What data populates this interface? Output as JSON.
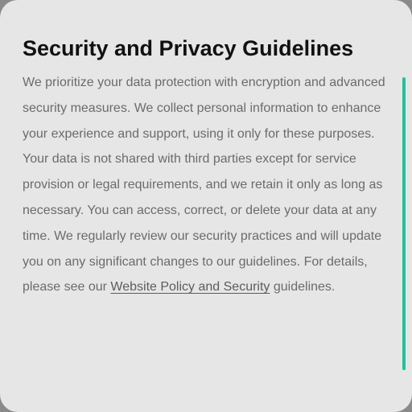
{
  "card": {
    "title": "Security and Privacy Guidelines",
    "body_text": "We prioritize your data protection with encryption and advanced security measures. We collect personal information to enhance your experience and support, using it only for these purposes. Your data is not shared with third parties except for service provision or legal requirements, and we retain it only as long as necessary. You can access, correct, or delete your data at any time. We regularly review our security practices and will update you on any significant changes to our guidelines. For details, please see our ",
    "policy_link_text": "Website Policy and Security",
    "body_suffix": " guidelines."
  },
  "colors": {
    "card_background": "#e6e6e6",
    "title": "#111111",
    "body_text": "#6b6b6b",
    "scrollbar_accent": "#22c29a"
  }
}
